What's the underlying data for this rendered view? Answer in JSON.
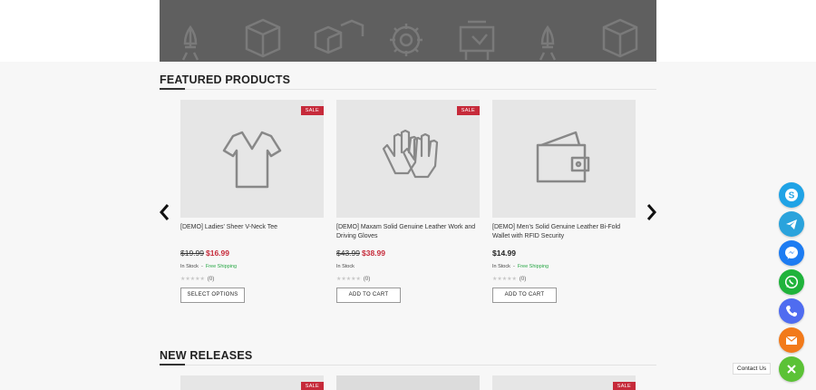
{
  "sections": {
    "featured_title": "FEATURED PRODUCTS",
    "new_releases_title": "NEW RELEASES"
  },
  "sale_badge": "SALE",
  "products": [
    {
      "name": "[DEMO] Ladies' Sheer V-Neck Tee",
      "old_price": "$19.99",
      "price": "$16.99",
      "stock": "In Stock",
      "shipping": "Free Shipping",
      "reviews": "(0)",
      "button": "SELECT OPTIONS",
      "icon": "tshirt-icon"
    },
    {
      "name": "[DEMO] Maxam Solid Genuine Leather Work and Driving Gloves",
      "old_price": "$43.99",
      "price": "$38.99",
      "stock": "In Stock",
      "shipping": "",
      "reviews": "(0)",
      "button": "ADD TO CART",
      "icon": "gloves-icon"
    },
    {
      "name": "[DEMO] Men's Solid Genuine Leather Bi-Fold Wallet with RFID Security",
      "old_price": "",
      "price": "$14.99",
      "stock": "In Stock",
      "shipping": "Free Shipping",
      "reviews": "(0)",
      "button": "ADD TO CART",
      "icon": "wallet-icon"
    }
  ],
  "separator": "-",
  "contact": {
    "tooltip": "Contact Us",
    "buttons": [
      {
        "icon": "skype-icon",
        "color": "#1fa3e6"
      },
      {
        "icon": "telegram-icon",
        "color": "#2aa3dc"
      },
      {
        "icon": "messenger-icon",
        "color": "#1d7cf2"
      },
      {
        "icon": "whatsapp-icon",
        "color": "#1fb33b"
      },
      {
        "icon": "phone-icon",
        "color": "#4f6cf0"
      },
      {
        "icon": "email-icon",
        "color": "#f27a1a"
      },
      {
        "icon": "close-icon",
        "color": "#5bc236"
      }
    ]
  },
  "colors": {
    "sale": "#c62a3a",
    "shipping": "#28a745",
    "banner": "#5f5f5f"
  }
}
